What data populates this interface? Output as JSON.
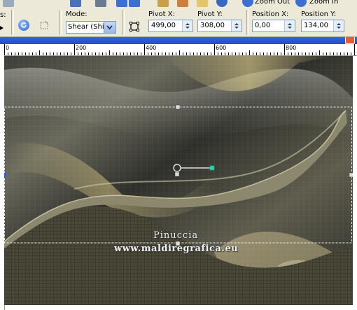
{
  "options": {
    "partial_label": "s:",
    "mode_label": "Mode:",
    "mode_value": "Shear (Shift",
    "pivot_x_label": "Pivot X:",
    "pivot_x_value": "499,00",
    "pivot_y_label": "Pivot Y:",
    "pivot_y_value": "308,00",
    "position_x_label": "Position X:",
    "position_x_value": "0,00",
    "position_y_label": "Position Y:",
    "position_y_value": "134,00"
  },
  "toolbar": {
    "zoom_out_label": "Zoom Out",
    "zoom_in_label": "Zoom In"
  },
  "ruler": {
    "labels": [
      "0",
      "200",
      "400",
      "600",
      "800"
    ]
  },
  "watermark": {
    "line1": "Pinuccia",
    "line2": "www.maldiregrafica.eu"
  },
  "colors": {
    "toolbar_bg": "#ece9d8",
    "titlebar": "#1e4fc9",
    "handle_line": "#ffffff"
  }
}
